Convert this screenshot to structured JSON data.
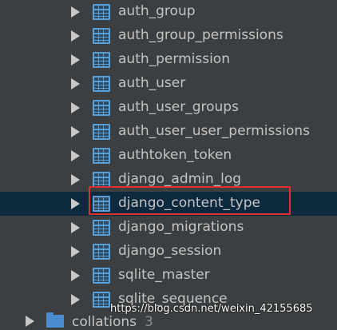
{
  "tables": [
    {
      "name": "auth_group",
      "icon": "table-icon"
    },
    {
      "name": "auth_group_permissions",
      "icon": "table-icon"
    },
    {
      "name": "auth_permission",
      "icon": "table-icon"
    },
    {
      "name": "auth_user",
      "icon": "table-icon"
    },
    {
      "name": "auth_user_groups",
      "icon": "table-icon"
    },
    {
      "name": "auth_user_user_permissions",
      "icon": "table-icon"
    },
    {
      "name": "authtoken_token",
      "icon": "table-icon"
    },
    {
      "name": "django_admin_log",
      "icon": "table-icon"
    },
    {
      "name": "django_content_type",
      "icon": "table-icon",
      "selected": true
    },
    {
      "name": "django_migrations",
      "icon": "table-icon"
    },
    {
      "name": "django_session",
      "icon": "table-icon"
    },
    {
      "name": "sqlite_master",
      "icon": "table-icon"
    },
    {
      "name": "sqlite_sequence",
      "icon": "table-icon"
    }
  ],
  "collations": {
    "label": "collations",
    "count": "3",
    "icon": "folder-icon"
  },
  "watermark": "https://blog.csdn.net/weixin_42155685",
  "colors": {
    "background": "#3c3f41",
    "selected_row": "#0d293e",
    "highlight_box": "#e02f2f",
    "icon_blue": "#5a9fd6"
  }
}
